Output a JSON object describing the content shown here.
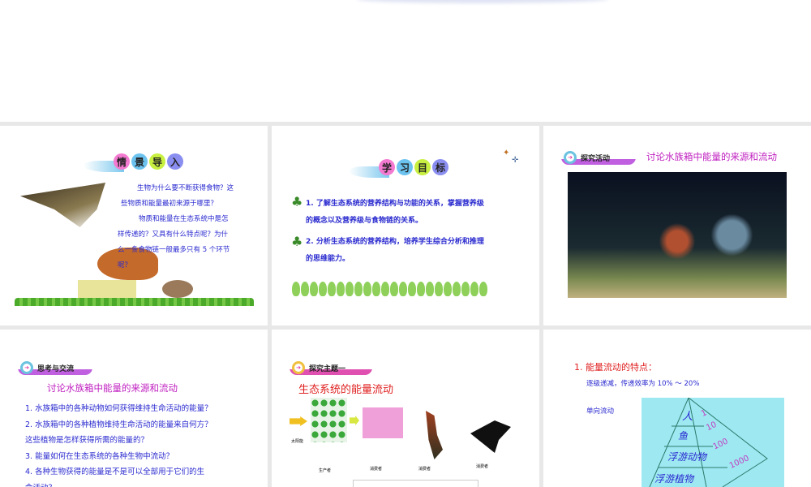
{
  "slides": [
    {
      "title_chars": [
        "情",
        "景",
        "导",
        "入"
      ],
      "paragraphs": [
        "生物为什么要不断获得食物？这",
        "些物质和能量最初来源于哪里？",
        "物质和能量在生态系统中是怎",
        "样传递的？又具有什么特点呢？为什",
        "么一条食物链一般最多只有 5 个环节",
        "呢？"
      ]
    },
    {
      "title_chars": [
        "学",
        "习",
        "目",
        "标"
      ],
      "items": [
        "1. 了解生态系统的营养结构与功能的关系，掌握营养级",
        "的概念以及营养级与食物链的关系。",
        "2. 分析生态系统的营养结构，培养学生综合分析和推理",
        "的思维能力。"
      ]
    },
    {
      "tag": "探究活动",
      "heading": "讨论水族箱中能量的来源和流动"
    },
    {
      "tag": "思考与交流",
      "heading": "讨论水族箱中能量的来源和流动",
      "items": [
        "1. 水族箱中的各种动物如何获得维持生命活动的能量？",
        "2. 水族箱中的各种植物维持生命活动的能量来自何方？",
        "这些植物是怎样获得所需的能量的？",
        "3. 能量如何在生态系统的各种生物中流动？",
        "4. 各种生物获得的能量是不是可以全部用于它们的生",
        "命活动？"
      ]
    },
    {
      "tag": "探究主题一",
      "heading": "生态系统的能量流动",
      "diagram": {
        "sun": "太阳能",
        "producer": "生产者",
        "consumer": "消费者"
      }
    },
    {
      "heading": "1. 能量流动的特点：",
      "line1": "逐级递减，传递效率为 10% ～ 20%",
      "line2": "单向流动",
      "pyramid": [
        "人",
        "鱼",
        "浮游动物",
        "浮游植物"
      ],
      "ratios": [
        "1",
        "10",
        "100",
        "1000"
      ]
    }
  ]
}
